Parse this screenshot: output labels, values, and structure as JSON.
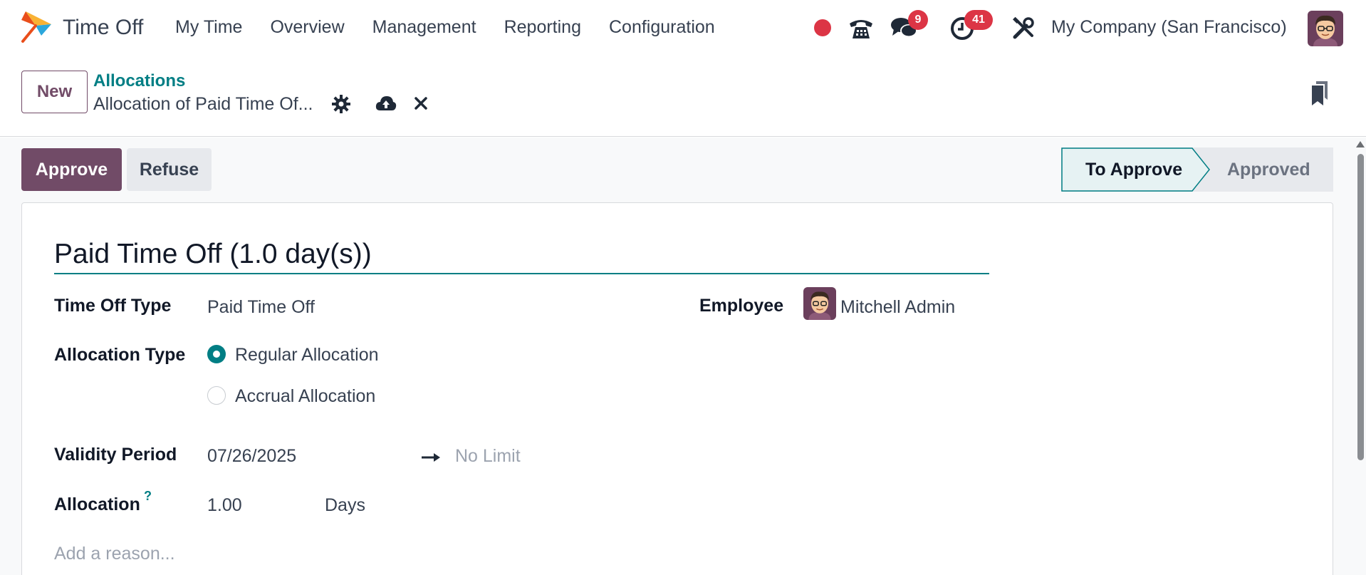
{
  "navbar": {
    "app_name": "Time Off",
    "menu": [
      "My Time",
      "Overview",
      "Management",
      "Reporting",
      "Configuration"
    ],
    "messages_badge": "9",
    "activities_badge": "41",
    "company": "My Company (San Francisco)",
    "icons": [
      "record-dot-icon",
      "phone-icon",
      "chat-icon",
      "clock-icon",
      "tools-icon"
    ]
  },
  "control": {
    "new_label": "New",
    "breadcrumb_parent": "Allocations",
    "breadcrumb_current": "Allocation of Paid Time Of...",
    "icons": [
      "gear-icon",
      "cloud-upload-icon",
      "close-icon",
      "bookmark-icon"
    ]
  },
  "actions": {
    "approve_label": "Approve",
    "refuse_label": "Refuse"
  },
  "status": {
    "stages": [
      "To Approve",
      "Approved"
    ],
    "current": "To Approve"
  },
  "form": {
    "title": "Paid Time Off (1.0 day(s))",
    "time_off_type_label": "Time Off Type",
    "time_off_type_value": "Paid Time Off",
    "employee_label": "Employee",
    "employee_value": "Mitchell Admin",
    "allocation_type_label": "Allocation Type",
    "allocation_type_options": [
      "Regular Allocation",
      "Accrual Allocation"
    ],
    "allocation_type_selected": "Regular Allocation",
    "validity_label": "Validity Period",
    "validity_start": "07/26/2025",
    "validity_end_placeholder": "No Limit",
    "allocation_label": "Allocation",
    "allocation_help": "?",
    "allocation_value": "1.00",
    "allocation_unit": "Days",
    "reason_placeholder": "Add a reason..."
  },
  "colors": {
    "brand": "#714b67",
    "accent": "#017e84",
    "badge": "#dc3545"
  }
}
